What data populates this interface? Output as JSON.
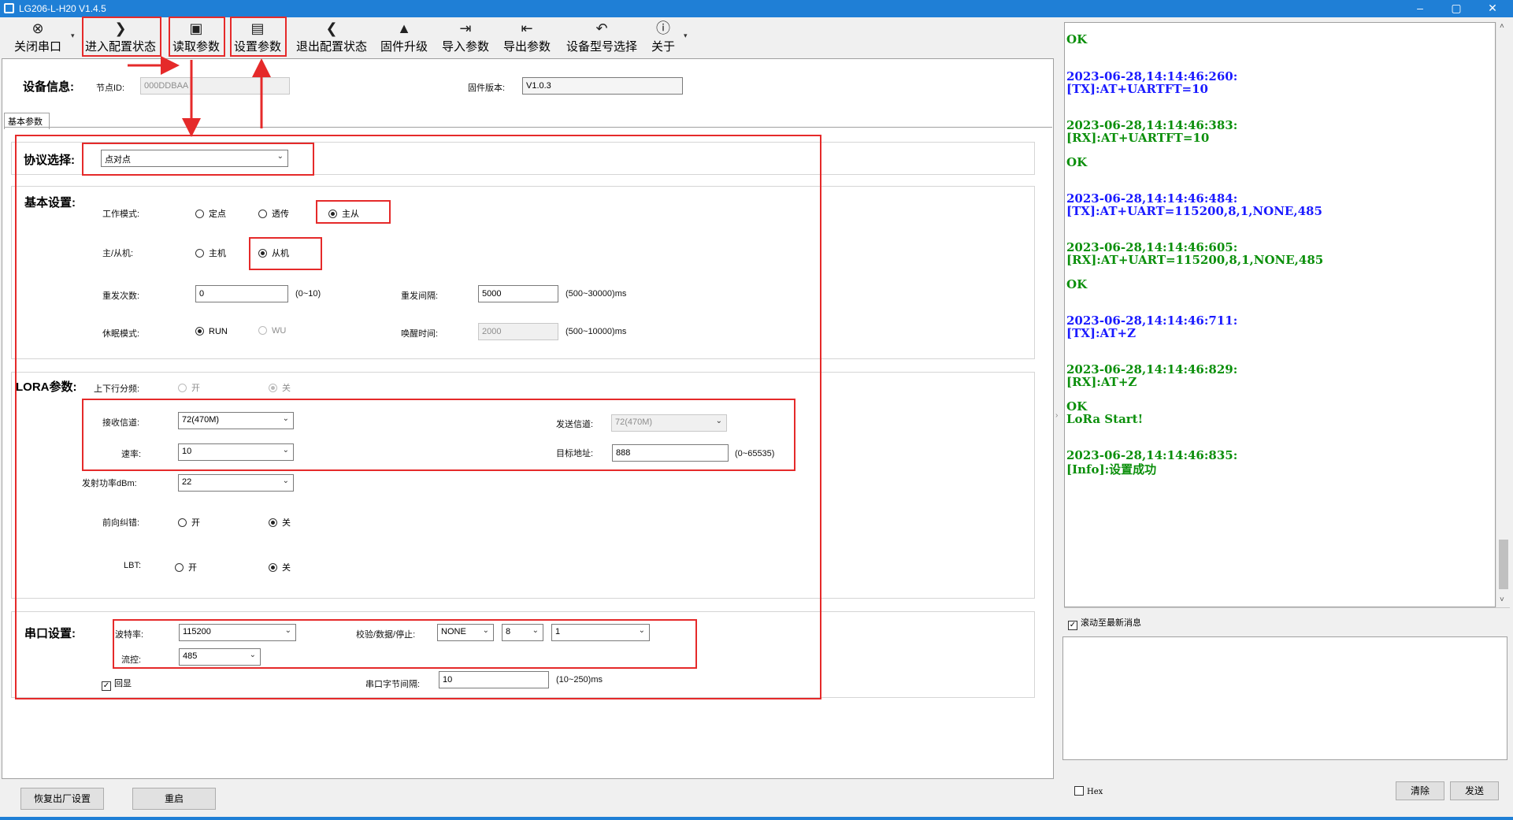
{
  "window": {
    "title": "LG206-L-H20 V1.4.5",
    "minimize": "–",
    "restore": "▢",
    "close": "✕"
  },
  "toolbar": {
    "items": [
      {
        "label": "关闭串口",
        "icon": "close-port-icon",
        "glyph": "⊗"
      },
      {
        "label": "进入配置状态",
        "icon": "chevron-right-icon",
        "glyph": "❯"
      },
      {
        "label": "读取参数",
        "icon": "read-params-icon",
        "glyph": "▣"
      },
      {
        "label": "设置参数",
        "icon": "save-icon",
        "glyph": "▤"
      },
      {
        "label": "退出配置状态",
        "icon": "chevron-left-icon",
        "glyph": "❮"
      },
      {
        "label": "固件升级",
        "icon": "rocket-icon",
        "glyph": "▲"
      },
      {
        "label": "导入参数",
        "icon": "import-icon",
        "glyph": "⇥"
      },
      {
        "label": "导出参数",
        "icon": "export-icon",
        "glyph": "⇤"
      },
      {
        "label": "设备型号选择",
        "icon": "undo-arrow-icon",
        "glyph": "↶"
      },
      {
        "label": "关于",
        "icon": "info-icon",
        "glyph": "ⓘ"
      }
    ],
    "caret": "▾"
  },
  "device_info": {
    "title": "设备信息:",
    "node_id_label": "节点ID:",
    "node_id_value": "000DDBAA",
    "firmware_label": "固件版本:",
    "firmware_value": "V1.0.3"
  },
  "tab": {
    "label": "基本参数"
  },
  "protocol": {
    "title": "协议选择:",
    "value": "点对点"
  },
  "basic": {
    "title": "基本设置:",
    "work_mode_label": "工作模式:",
    "work_mode_options": [
      "定点",
      "透传",
      "主从"
    ],
    "role_label": "主/从机:",
    "role_options": [
      "主机",
      "从机"
    ],
    "retry_count_label": "重发次数:",
    "retry_count_value": "0",
    "retry_count_range": "(0~10)",
    "retry_interval_label": "重发间隔:",
    "retry_interval_value": "5000",
    "retry_interval_range": "(500~30000)ms",
    "sleep_mode_label": "休眠模式:",
    "sleep_mode_options": [
      "RUN",
      "WU"
    ],
    "wake_time_label": "唤醒时间:",
    "wake_time_value": "2000",
    "wake_time_range": "(500~10000)ms"
  },
  "lora": {
    "title": "LORA参数:",
    "updown_label": "上下行分频:",
    "on": "开",
    "off": "关",
    "rx_channel_label": "接收信道:",
    "rx_channel_value": "72(470M)",
    "tx_channel_label": "发送信道:",
    "tx_channel_value": "72(470M)",
    "rate_label": "速率:",
    "rate_value": "10",
    "target_addr_label": "目标地址:",
    "target_addr_value": "888",
    "target_addr_range": "(0~65535)",
    "power_label": "发射功率dBm:",
    "power_value": "22",
    "fec_label": "前向纠错:",
    "lbt_label": "LBT:"
  },
  "serial": {
    "title": "串口设置:",
    "baud_label": "波特率:",
    "baud_value": "115200",
    "parity_label": "校验/数据/停止:",
    "parity_value": "NONE",
    "data_bits_value": "8",
    "stop_bits_value": "1",
    "flow_label": "流控:",
    "flow_value": "485",
    "echo_label": "回显",
    "byte_interval_label": "串口字节间隔:",
    "byte_interval_value": "10",
    "byte_interval_range": "(10~250)ms"
  },
  "bottom_buttons": {
    "factory_reset": "恢复出厂设置",
    "restart": "重启"
  },
  "log": {
    "lines": [
      {
        "text": "OK",
        "color": "green"
      },
      {
        "text": "2023-06-28,14:14:46:260:",
        "color": "blue"
      },
      {
        "text": "[TX]:AT+UARTFT=10",
        "color": "blue"
      },
      {
        "text": "2023-06-28,14:14:46:383:",
        "color": "green"
      },
      {
        "text": "[RX]:AT+UARTFT=10",
        "color": "green"
      },
      {
        "text": "OK",
        "color": "green"
      },
      {
        "text": "2023-06-28,14:14:46:484:",
        "color": "blue"
      },
      {
        "text": "[TX]:AT+UART=115200,8,1,NONE,485",
        "color": "blue"
      },
      {
        "text": "2023-06-28,14:14:46:605:",
        "color": "green"
      },
      {
        "text": "[RX]:AT+UART=115200,8,1,NONE,485",
        "color": "green"
      },
      {
        "text": "OK",
        "color": "green"
      },
      {
        "text": "2023-06-28,14:14:46:711:",
        "color": "blue"
      },
      {
        "text": "[TX]:AT+Z",
        "color": "blue"
      },
      {
        "text": "2023-06-28,14:14:46:829:",
        "color": "green"
      },
      {
        "text": "[RX]:AT+Z",
        "color": "green"
      },
      {
        "text": "OK",
        "color": "green"
      },
      {
        "text": "LoRa Start!",
        "color": "green"
      },
      {
        "text": "2023-06-28,14:14:46:835:",
        "color": "green"
      },
      {
        "text": "[Info]:设置成功",
        "color": "green"
      }
    ],
    "autoscroll_label": "滚动至最新消息",
    "hex_label": "Hex",
    "clear_label": "清除",
    "send_label": "发送"
  },
  "colors": {
    "title_bar": "#1f7fd6",
    "annotation_red": "#e52a2a",
    "log_blue": "#1a1aff",
    "log_green": "#0b8f0b"
  }
}
